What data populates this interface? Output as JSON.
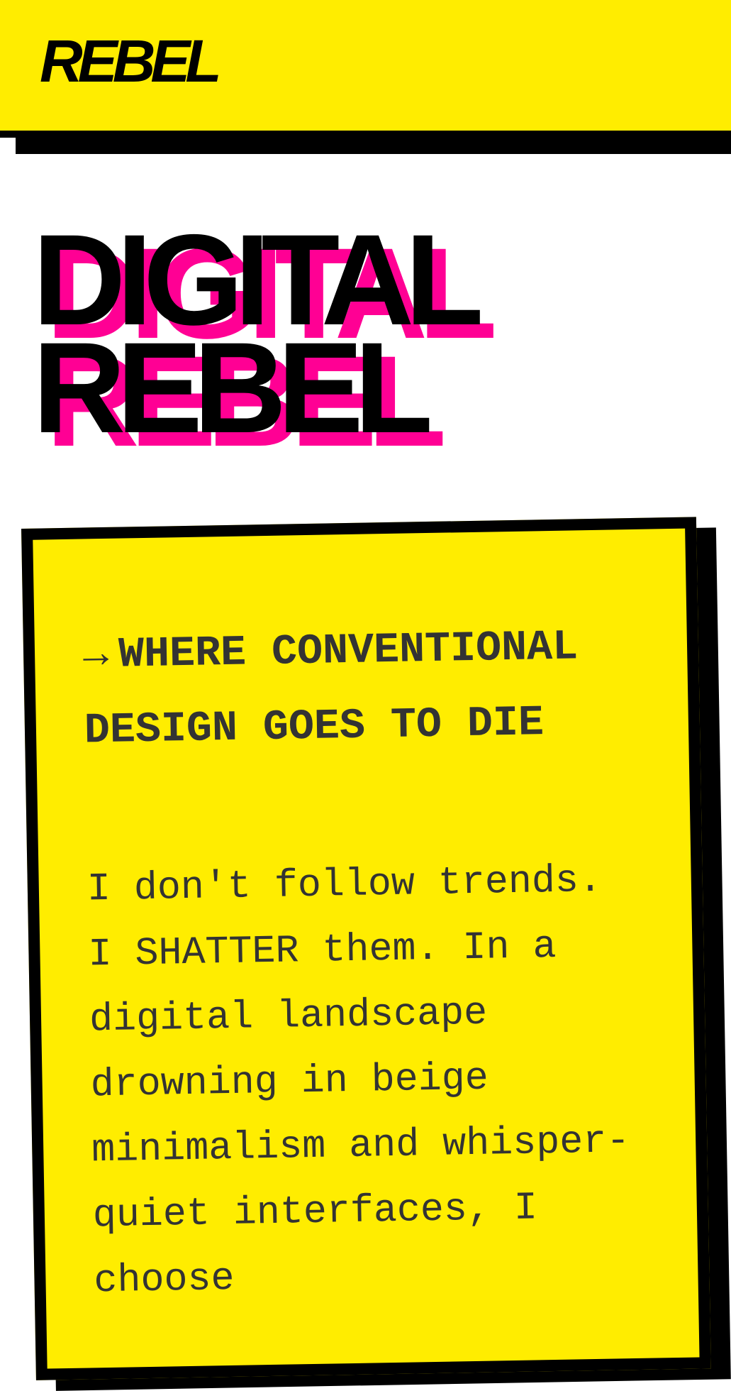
{
  "header": {
    "logo": "REBEL"
  },
  "hero": {
    "line1": "DIGITAL",
    "line2": "REBEL"
  },
  "card": {
    "arrow_icon": "→",
    "tagline": "WHERE CONVENTIONAL DESIGN GOES TO DIE",
    "body": "I don't follow trends. I SHATTER them. In a digital landscape drowning in beige minimalism and whisper-quiet interfaces, I choose"
  },
  "colors": {
    "yellow": "#FFED00",
    "pink": "#FF0094",
    "black": "#000000",
    "text": "#333333"
  }
}
